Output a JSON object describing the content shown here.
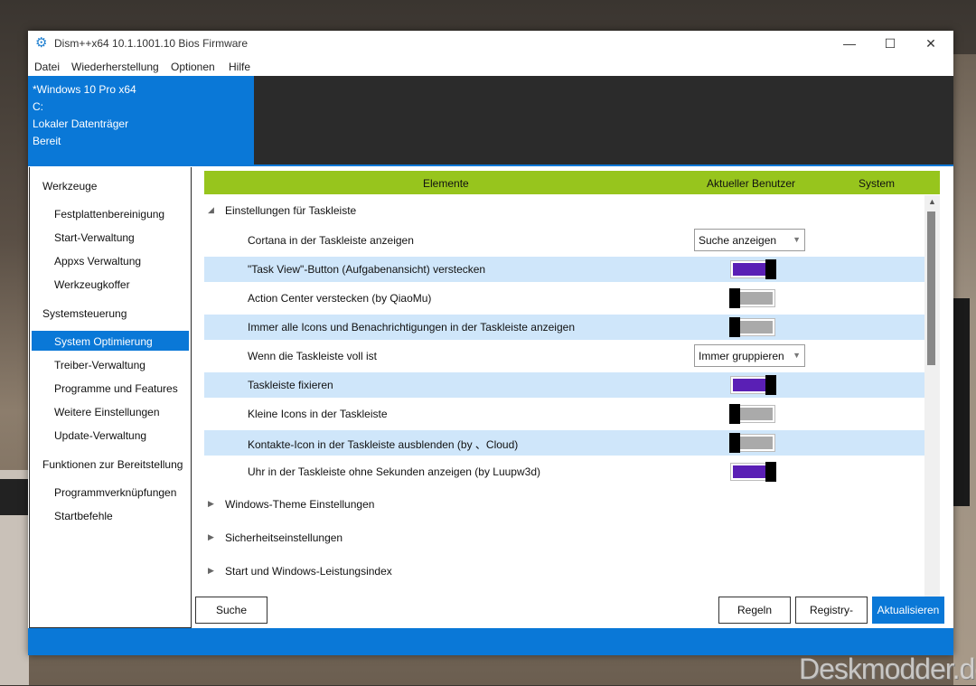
{
  "window": {
    "title": "Dism++x64 10.1.1001.10 Bios Firmware",
    "minimize": "—",
    "maximize": "☐",
    "close": "✕"
  },
  "menu": [
    "Datei",
    "Wiederherstellung",
    "Optionen",
    "Hilfe"
  ],
  "header": {
    "os": "*Windows 10 Pro x64",
    "drive": "C:",
    "disk": "Lokaler Datenträger",
    "status": "Bereit"
  },
  "sidebar": {
    "sections": [
      {
        "title": "Werkzeuge",
        "items": [
          "Festplattenbereinigung",
          "Start-Verwaltung",
          "Appxs Verwaltung",
          "Werkzeugkoffer"
        ]
      },
      {
        "title": "Systemsteuerung",
        "items": [
          "System Optimierung",
          "Treiber-Verwaltung",
          "Programme und Features",
          "Weitere Einstellungen",
          "Update-Verwaltung"
        ]
      },
      {
        "title": "Funktionen zur Bereitstellung",
        "items": [
          "Programmverknüpfungen",
          "Startbefehle"
        ]
      }
    ],
    "selected": "System Optimierung"
  },
  "table": {
    "columns": [
      "Elemente",
      "Aktueller Benutzer",
      "System"
    ],
    "expanded_group": "Einstellungen für Taskleiste",
    "rows": [
      {
        "label": "Cortana in der Taskleiste anzeigen",
        "type": "select",
        "value": "Suche anzeigen"
      },
      {
        "label": "\"Task View\"-Button (Aufgabenansicht) verstecken",
        "type": "toggle",
        "on": true
      },
      {
        "label": "Action Center verstecken (by QiaoMu)",
        "type": "toggle",
        "on": false
      },
      {
        "label": "Immer alle Icons und Benachrichtigungen in der Taskleiste anzeigen",
        "type": "toggle",
        "on": false
      },
      {
        "label": "Wenn die Taskleiste voll ist",
        "type": "select",
        "value": "Immer gruppieren"
      },
      {
        "label": "Taskleiste fixieren",
        "type": "toggle",
        "on": true
      },
      {
        "label": "Kleine Icons in der Taskleiste",
        "type": "toggle",
        "on": false
      },
      {
        "label": "Kontakte-Icon in der Taskleiste ausblenden (by 、Cloud)",
        "type": "toggle",
        "on": false
      },
      {
        "label": "Uhr in der Taskleiste ohne Sekunden anzeigen (by Luupw3d)",
        "type": "toggle",
        "on": true
      }
    ],
    "collapsed_groups": [
      "Windows-Theme Einstellungen",
      "Sicherheitseinstellungen",
      "Start und Windows-Leistungsindex"
    ]
  },
  "buttons": {
    "search": "Suche",
    "create_rules": "Regeln erstellen",
    "registry_import": "Registry-Import",
    "refresh": "Aktualisieren"
  },
  "watermark": "Deskmodder.de",
  "colors": {
    "accent": "#0a78d7",
    "header_green": "#97c51d",
    "row_alt": "#cfe6fa",
    "toggle_on": "#5a1fb5",
    "toggle_off": "#aaaaaa"
  }
}
